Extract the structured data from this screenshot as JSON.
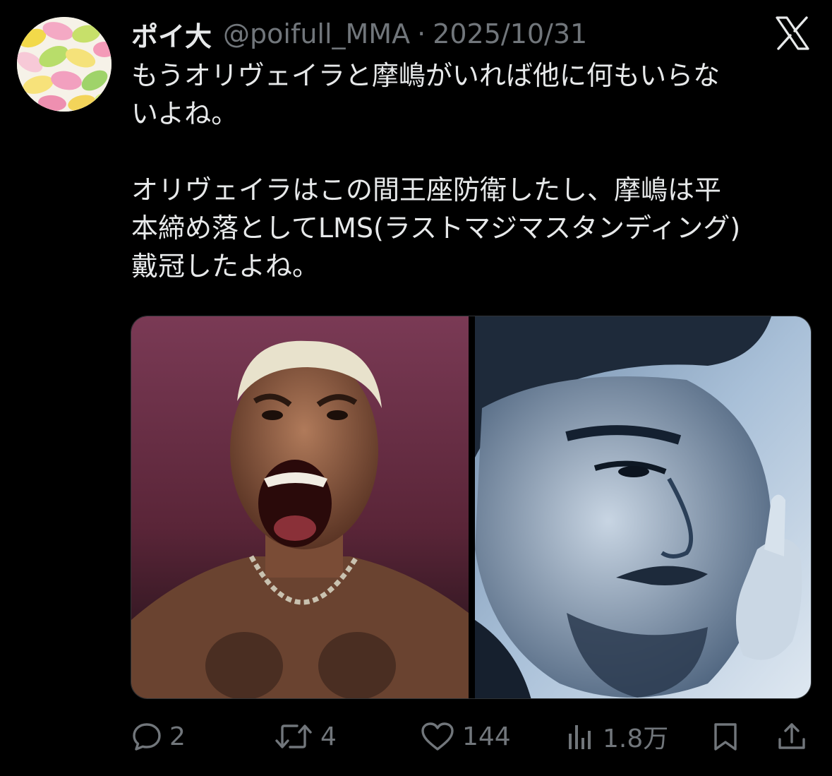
{
  "tweet": {
    "display_name": "ポイ大",
    "handle": "@poifull_MMA",
    "separator": "·",
    "date": "2025/10/31",
    "text_lines": [
      "もうオリヴェイラと摩嶋がいれば他に何もいらな",
      "いよね。",
      "",
      "オリヴェイラはこの間王座防衛したし、摩嶋は平",
      "本締め落としてLMS(ラストマジマスタンディング)",
      "戴冠したよね。"
    ]
  },
  "actions": {
    "reply_count": "2",
    "retweet_count": "4",
    "like_count": "144",
    "view_count": "1.8万"
  },
  "icons": {
    "platform": "x-logo",
    "reply": "reply-icon",
    "retweet": "retweet-icon",
    "like": "heart-icon",
    "views": "views-icon",
    "bookmark": "bookmark-icon",
    "share": "share-icon"
  },
  "colors": {
    "background": "#000000",
    "text_primary": "#e7e9ea",
    "text_secondary": "#71767b"
  }
}
